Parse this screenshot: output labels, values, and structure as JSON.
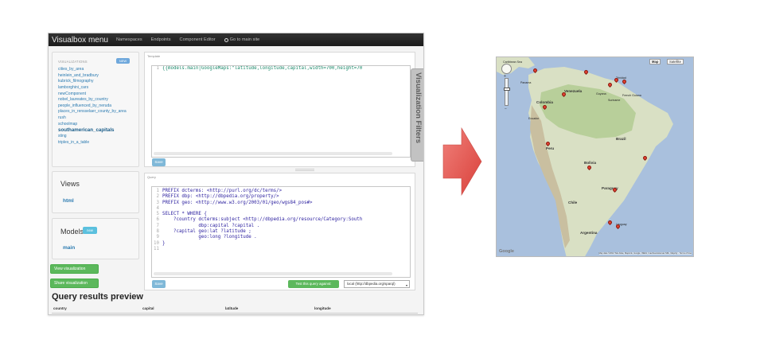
{
  "navbar": {
    "brand": "Visualbox menu",
    "links": [
      "Namespaces",
      "Endpoints",
      "Component Editor"
    ],
    "home_link": "Go to main site"
  },
  "visualizations": {
    "header": "VISUALIZATIONS",
    "new_label": "NEW",
    "items": [
      "cities_by_area",
      "heinlein_and_bradbury",
      "kubrick_filmography",
      "lamborghini_cars",
      "newComponent",
      "nobel_laureates_by_country",
      "people_influenced_by_neruda",
      "places_in_rensselaer_county_by_area",
      "rush",
      "schoolmap",
      "southamerican_capitals",
      "sting",
      "triples_in_a_table"
    ],
    "active_item": "southamerican_capitals"
  },
  "views": {
    "title": "Views",
    "item": "html"
  },
  "models": {
    "title": "Models",
    "new_label": "new",
    "item": "main"
  },
  "buttons": {
    "view": "View visualization",
    "share": "Share visualization",
    "save": "Save",
    "test_query": "Test this query against:"
  },
  "template": {
    "label": "Template",
    "line_numbers": [
      "1"
    ],
    "lines": [
      "{{models.main|GoogleMaps:\"latitude,longitude,capital,width=700,height=70"
    ]
  },
  "query": {
    "label": "Query",
    "line_numbers": [
      "1",
      "2",
      "3",
      "4",
      "5",
      "6",
      "7",
      "8",
      "9",
      "10",
      "11"
    ],
    "lines": [
      "PREFIX dcterms: <http://purl.org/dc/terms/>",
      "PREFIX dbp: <http://dbpedia.org/property/>",
      "PREFIX geo: <http://www.w3.org/2003/01/geo/wgs84_pos#>",
      "",
      "SELECT * WHERE {",
      "    ?country dcterms:subject <http://dbpedia.org/resource/Category:South",
      "             dbp:capital ?capital .",
      "    ?capital geo:lat ?latitude ;",
      "             geo:long ?longitude .",
      "}",
      ""
    ],
    "endpoint": "local (http://dbpedia.org/sparql)"
  },
  "filters_tab": "Visualization Filters",
  "preview": {
    "title": "Query results preview",
    "columns": [
      "country",
      "capital",
      "latitude",
      "longitude"
    ]
  },
  "map": {
    "map_button": "Map",
    "satellite_button": "Satellite",
    "places": [
      "Caribbean Sea",
      "Trinidad",
      "Panama",
      "Venezuela",
      "Colombia",
      "Guyana",
      "Suriname",
      "French Guiana",
      "Ecuador",
      "Peru",
      "Brazil",
      "Bolivia",
      "Paraguay",
      "Chile",
      "Argentina",
      "Uruguay"
    ],
    "copyright": "Map data ©2012 Tele Atlas, MapLink, Google, INEGI, Inav/Geosistemas SRL, Mapcity - Terms of Use",
    "logo": "Google",
    "colors": {
      "water": "#a9c0dd",
      "land": "#d9e0c4",
      "forest": "#b8cf9a",
      "marker": "#e04030"
    }
  },
  "arrow_color": "#e25550"
}
